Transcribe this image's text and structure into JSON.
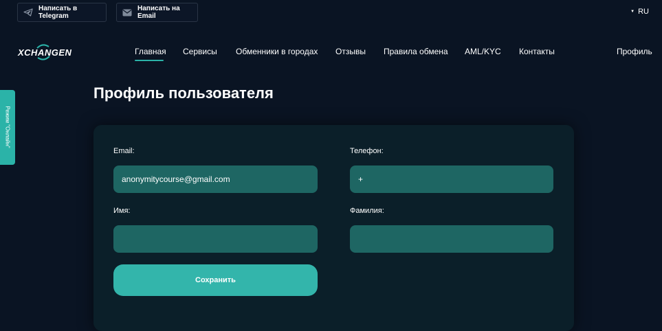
{
  "topbar": {
    "telegram_label": "Написать в Telegram",
    "email_label": "Написать на Email",
    "language": "RU"
  },
  "header": {
    "logo_text": "XCHANGEN",
    "nav": [
      {
        "label": "Главная",
        "active": true
      },
      {
        "label": "Сервисы"
      },
      {
        "label": "Обменники в городах"
      },
      {
        "label": "Отзывы"
      },
      {
        "label": "Правила обмена"
      },
      {
        "label": "AML/KYC"
      },
      {
        "label": "Контакты"
      }
    ],
    "profile_label": "Профиль"
  },
  "side_tab": {
    "label": "Режим \"Онлайн\""
  },
  "page": {
    "title": "Профиль пользователя"
  },
  "form": {
    "email": {
      "label": "Email:",
      "value": "anonymitycourse@gmail.com"
    },
    "phone": {
      "label": "Телефон:",
      "value": "+"
    },
    "first_name": {
      "label": "Имя:",
      "value": ""
    },
    "last_name": {
      "label": "Фамилия:",
      "value": ""
    },
    "save_label": "Сохранить"
  },
  "colors": {
    "background": "#0a1423",
    "card": "#0b1f29",
    "field": "#1e6663",
    "accent": "#2bb3a8"
  }
}
